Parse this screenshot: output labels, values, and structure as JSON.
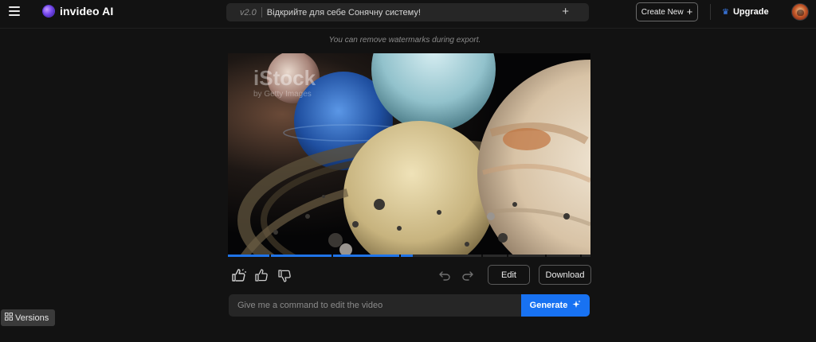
{
  "header": {
    "logo_text": "invideo AI",
    "prompt": {
      "version": "v2.0",
      "text": "Відкрийте для себе Сонячну систему!",
      "add_symbol": "+"
    },
    "create_new_label": "Create New",
    "create_new_symbol": "+",
    "upgrade_label": "Upgrade",
    "upgrade_icon": "crown-icon"
  },
  "notice": "You can remove watermarks during export.",
  "video": {
    "description_icon": "video-frame",
    "watermark_main": "iStock",
    "watermark_sub": "by Getty Images",
    "progress": 0.51
  },
  "actions": {
    "edit_label": "Edit",
    "download_label": "Download"
  },
  "command": {
    "placeholder": "Give me a command to edit the video",
    "generate_label": "Generate"
  },
  "versions_label": "Versions",
  "colors": {
    "background": "#121212",
    "accent": "#1872f2",
    "surface": "#262626",
    "progress": "#1f74e8"
  }
}
